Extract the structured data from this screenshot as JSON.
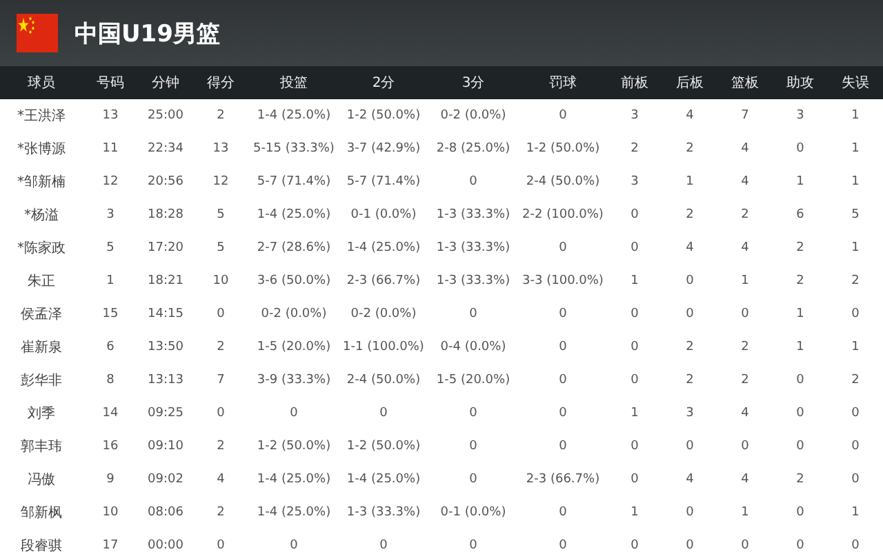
{
  "header": {
    "title": "中国U19男篮"
  },
  "table": {
    "columns": [
      "球员",
      "号码",
      "分钟",
      "得分",
      "投篮",
      "2分",
      "3分",
      "罚球",
      "前板",
      "后板",
      "篮板",
      "助攻",
      "失误"
    ],
    "rows": [
      [
        "*王洪泽",
        "13",
        "25:00",
        "2",
        "1-4 (25.0%)",
        "1-2 (50.0%)",
        "0-2 (0.0%)",
        "0",
        "3",
        "4",
        "7",
        "3",
        "1"
      ],
      [
        "*张博源",
        "11",
        "22:34",
        "13",
        "5-15 (33.3%)",
        "3-7 (42.9%)",
        "2-8 (25.0%)",
        "1-2 (50.0%)",
        "2",
        "2",
        "4",
        "0",
        "1"
      ],
      [
        "*邹新楠",
        "12",
        "20:56",
        "12",
        "5-7 (71.4%)",
        "5-7 (71.4%)",
        "0",
        "2-4 (50.0%)",
        "3",
        "1",
        "4",
        "1",
        "1"
      ],
      [
        "*杨溢",
        "3",
        "18:28",
        "5",
        "1-4 (25.0%)",
        "0-1 (0.0%)",
        "1-3 (33.3%)",
        "2-2 (100.0%)",
        "0",
        "2",
        "2",
        "6",
        "5"
      ],
      [
        "*陈家政",
        "5",
        "17:20",
        "5",
        "2-7 (28.6%)",
        "1-4 (25.0%)",
        "1-3 (33.3%)",
        "0",
        "0",
        "4",
        "4",
        "2",
        "1"
      ],
      [
        "朱正",
        "1",
        "18:21",
        "10",
        "3-6 (50.0%)",
        "2-3 (66.7%)",
        "1-3 (33.3%)",
        "3-3 (100.0%)",
        "1",
        "0",
        "1",
        "2",
        "2"
      ],
      [
        "侯孟泽",
        "15",
        "14:15",
        "0",
        "0-2 (0.0%)",
        "0-2 (0.0%)",
        "0",
        "0",
        "0",
        "0",
        "0",
        "1",
        "0"
      ],
      [
        "崔新泉",
        "6",
        "13:50",
        "2",
        "1-5 (20.0%)",
        "1-1 (100.0%)",
        "0-4 (0.0%)",
        "0",
        "0",
        "2",
        "2",
        "1",
        "1"
      ],
      [
        "彭华非",
        "8",
        "13:13",
        "7",
        "3-9 (33.3%)",
        "2-4 (50.0%)",
        "1-5 (20.0%)",
        "0",
        "0",
        "2",
        "2",
        "0",
        "2"
      ],
      [
        "刘季",
        "14",
        "09:25",
        "0",
        "0",
        "0",
        "0",
        "0",
        "1",
        "3",
        "4",
        "0",
        "0"
      ],
      [
        "郭丰玮",
        "16",
        "09:10",
        "2",
        "1-2 (50.0%)",
        "1-2 (50.0%)",
        "0",
        "0",
        "0",
        "0",
        "0",
        "0",
        "0"
      ],
      [
        "冯傲",
        "9",
        "09:02",
        "4",
        "1-4 (25.0%)",
        "1-4 (25.0%)",
        "0",
        "2-3 (66.7%)",
        "0",
        "4",
        "4",
        "2",
        "0"
      ],
      [
        "邹新枫",
        "10",
        "08:06",
        "2",
        "1-4 (25.0%)",
        "1-3 (33.3%)",
        "0-1 (0.0%)",
        "0",
        "1",
        "0",
        "1",
        "0",
        "1"
      ],
      [
        "段睿骐",
        "17",
        "00:00",
        "0",
        "0",
        "0",
        "0",
        "0",
        "0",
        "0",
        "0",
        "0",
        "0"
      ]
    ]
  }
}
